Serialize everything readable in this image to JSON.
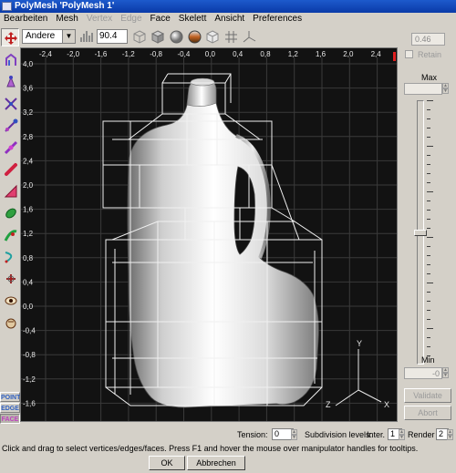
{
  "titlebar": {
    "title": "PolyMesh 'PolyMesh 1'"
  },
  "menu": {
    "items": [
      "Bearbeiten",
      "Mesh",
      "Vertex",
      "Edge",
      "Face",
      "Skelett",
      "Ansicht",
      "Preferences"
    ],
    "disabled": [
      "Vertex",
      "Edge"
    ]
  },
  "toolbar": {
    "view_select": "Andere",
    "zoom_value": "90.4",
    "icons": [
      "histogram-icon",
      "wireframe-cube-icon",
      "shaded-cube-icon",
      "smooth-sphere-icon",
      "textured-sphere-icon",
      "transparent-cube-icon",
      "grid-icon",
      "axes-icon"
    ]
  },
  "tools": {
    "icons": [
      "move-tool-icon",
      "bevel-tool-icon",
      "extrude-tool-icon",
      "scale-tool-icon",
      "rotate-tool-icon",
      "skew-tool-icon",
      "taper-tool-icon",
      "thicken-tool-icon",
      "bulge-tool-icon",
      "skeleton-tool-icon",
      "spline-tool-icon",
      "camera-tool-icon",
      "eye-tool-icon",
      "hand-tool-icon"
    ]
  },
  "modes": {
    "point": "POINT",
    "edge": "EDGE",
    "face": "FACE"
  },
  "viewport": {
    "x_ticks": [
      "-2,4",
      "-2,0",
      "-1,6",
      "-1,2",
      "-0,8",
      "-0,4",
      "0,0",
      "0,4",
      "0,8",
      "1,2",
      "1,6",
      "2,0",
      "2,4"
    ],
    "y_ticks": [
      "4,0",
      "3,6",
      "3,2",
      "2,8",
      "2,4",
      "2,0",
      "1,6",
      "1,2",
      "0,8",
      "0,4",
      "0,0",
      "-0,4",
      "-0,8",
      "-1,2",
      "-1,6",
      "-2,0"
    ],
    "axes_labels": {
      "y": "Y",
      "z": "Z",
      "x": "X"
    },
    "colors": {
      "background": "#121212",
      "grid": "#3a3a3a",
      "wire": "#f0f0f0",
      "tick": "#e8e8e8"
    }
  },
  "rightpanel": {
    "weight_value": "0.46",
    "retain_label": "Retain",
    "max_label": "Max",
    "min_label": "Min",
    "slider_level": 0.5,
    "validate_label": "Validate",
    "abort_label": "Abort"
  },
  "bottom": {
    "tension_label": "Tension:",
    "tension_value": "0",
    "subdivision_label": "Subdivision levels:",
    "inter_label": "Inter.",
    "inter_value": "1",
    "render_label": "Render",
    "render_value": "2",
    "status": "Click and drag to select vertices/edges/faces. Press F1 and hover the mouse over manipulator handles for tooltips.",
    "ok_label": "OK",
    "cancel_label": "Abbrechen"
  }
}
